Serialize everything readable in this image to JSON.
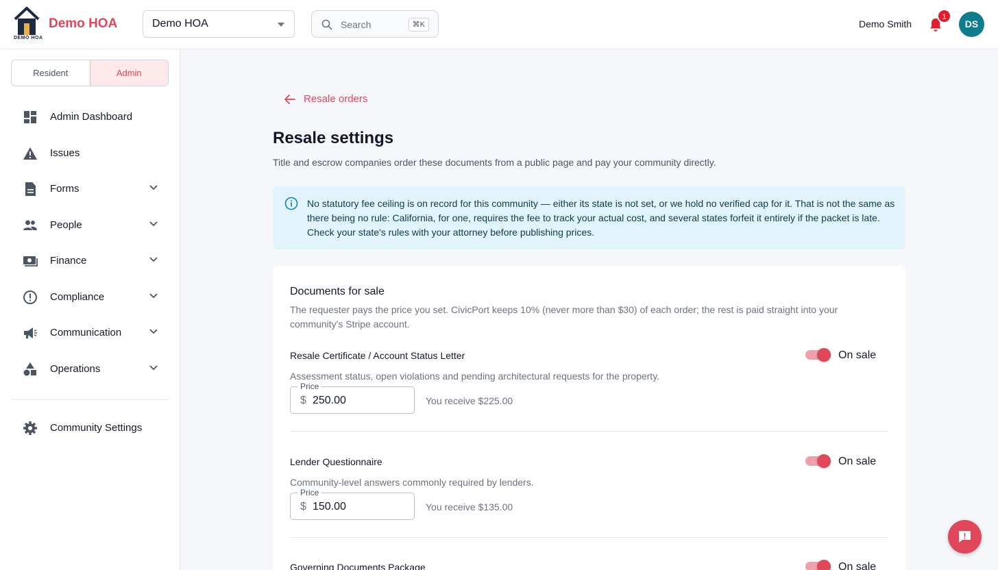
{
  "header": {
    "logo_caption": "DEMO HOA",
    "brand": "Demo HOA",
    "community_select": "Demo HOA",
    "search_placeholder": "Search",
    "search_shortcut": "⌘K",
    "user_name": "Demo Smith",
    "notification_count": "1",
    "avatar_initials": "DS"
  },
  "sidebar": {
    "mode_toggle": {
      "resident": "Resident",
      "admin": "Admin",
      "active": "admin"
    },
    "items": [
      {
        "label": "Admin Dashboard",
        "icon": "dashboard-icon",
        "expandable": false
      },
      {
        "label": "Issues",
        "icon": "warning-icon",
        "expandable": false
      },
      {
        "label": "Forms",
        "icon": "document-icon",
        "expandable": true
      },
      {
        "label": "People",
        "icon": "people-icon",
        "expandable": true
      },
      {
        "label": "Finance",
        "icon": "money-icon",
        "expandable": true
      },
      {
        "label": "Compliance",
        "icon": "alert-circle-icon",
        "expandable": true
      },
      {
        "label": "Communication",
        "icon": "megaphone-icon",
        "expandable": true
      },
      {
        "label": "Operations",
        "icon": "shapes-icon",
        "expandable": true
      }
    ],
    "settings_label": "Community Settings"
  },
  "main": {
    "back_link": "Resale orders",
    "title": "Resale settings",
    "subtitle": "Title and escrow companies order these documents from a public page and pay your community directly.",
    "info": "No statutory fee ceiling is on record for this community — either its state is not set, or we hold no verified cap for it. That is not the same as there being no rule: California, for one, requires the fee to track your actual cost, and several states forfeit it entirely if the packet is late. Check your state's rules with your attorney before publishing prices.",
    "card": {
      "title": "Documents for sale",
      "description": "The requester pays the price you set. CivicPort keeps 10% (never more than $30) of each order; the rest is paid straight into your community's Stripe account.",
      "price_label": "Price",
      "currency_symbol": "$",
      "documents": [
        {
          "name": "Resale Certificate / Account Status Letter",
          "status": "On sale",
          "on_sale": true,
          "description": "Assessment status, open violations and pending architectural requests for the property.",
          "price": "250.00",
          "receive": "You receive $225.00"
        },
        {
          "name": "Lender Questionnaire",
          "status": "On sale",
          "on_sale": true,
          "description": "Community-level answers commonly required by lenders.",
          "price": "150.00",
          "receive": "You receive $135.00"
        },
        {
          "name": "Governing Documents Package",
          "status": "On sale",
          "on_sale": true
        }
      ]
    }
  },
  "colors": {
    "accent": "#e0475a",
    "avatar": "#0e7c8a",
    "info_bg": "#e1f4fb"
  }
}
